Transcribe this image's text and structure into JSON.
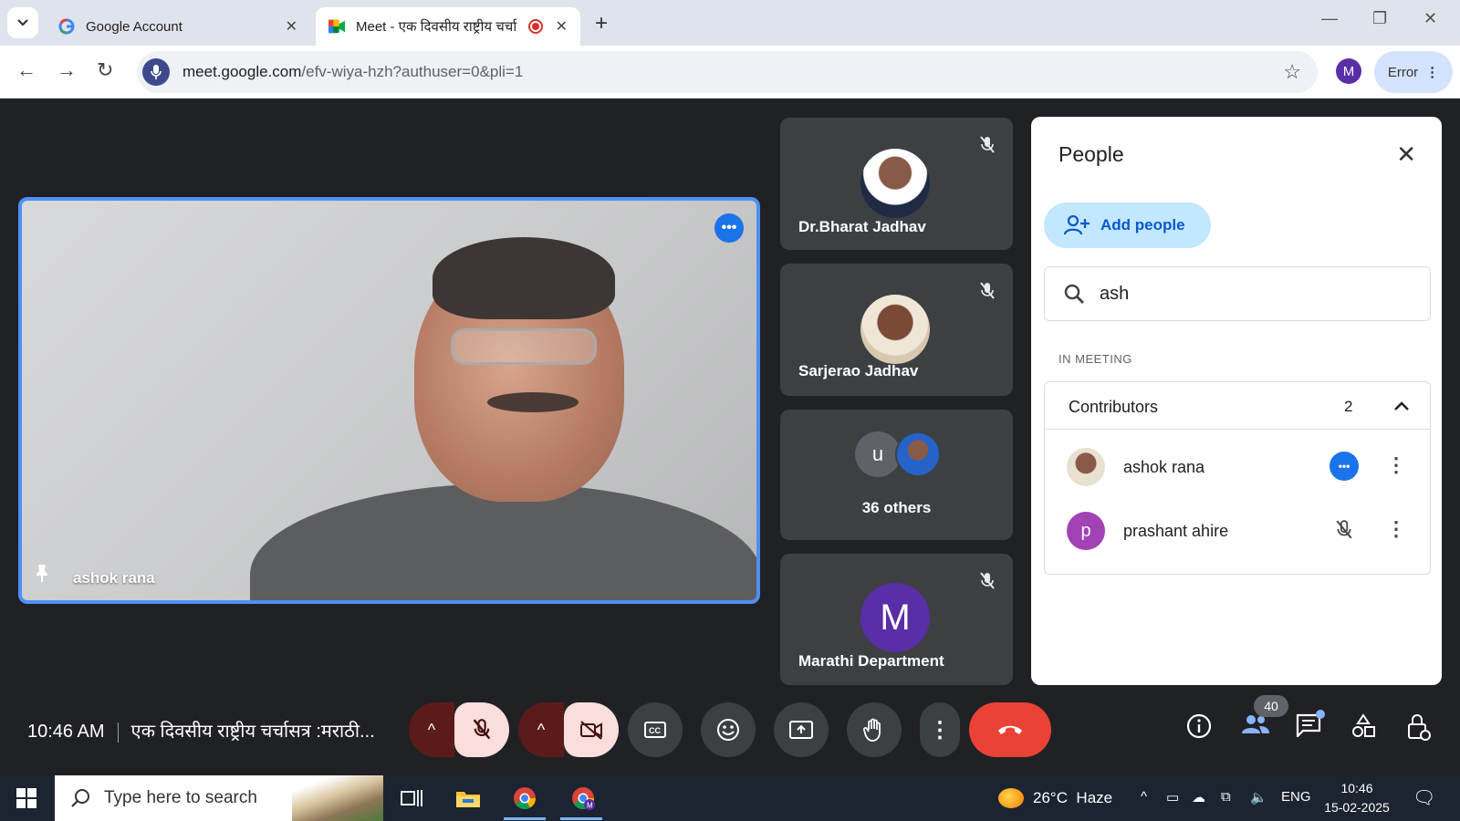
{
  "browser": {
    "tabs": [
      {
        "title": "Google Account",
        "favicon": "google-g-icon"
      },
      {
        "title": "Meet - एक दिवसीय राष्ट्रीय चर्चा",
        "favicon": "google-meet-icon",
        "recording": true
      }
    ],
    "url_host": "meet.google.com",
    "url_path": "/efv-wiya-hzh?authuser=0&pli=1",
    "profile_initial": "M",
    "error_label": "Error"
  },
  "meet": {
    "main_tile": {
      "name": "ashok rana"
    },
    "side_tiles": [
      {
        "name": "Dr.Bharat Jadhav",
        "muted": true
      },
      {
        "name": "Sarjerao Jadhav",
        "muted": true
      },
      {
        "avatar_letter": "u",
        "label": "36 others"
      },
      {
        "name": "Marathi Department",
        "avatar_letter": "M",
        "muted": true
      }
    ],
    "time": "10:46 AM",
    "meeting_title": "एक दिवसीय राष्ट्रीय चर्चासत्र :मराठी...",
    "participant_count": "40",
    "colors": {
      "accent": "#1a73e8",
      "hangup": "#ea4335",
      "panel_bg": "#ffffff",
      "tile_bg": "#3c4043"
    }
  },
  "people_panel": {
    "title": "People",
    "add_people_label": "Add people",
    "search_value": "ash",
    "section_label": "IN MEETING",
    "contributors_label": "Contributors",
    "contributors_count": "2",
    "participants": [
      {
        "name": "ashok rana",
        "status": "speaking"
      },
      {
        "name": "prashant ahire",
        "avatar_letter": "p",
        "status": "muted"
      }
    ]
  },
  "taskbar": {
    "search_placeholder": "Type here to search",
    "weather": "26°C  Haze",
    "language": "ENG",
    "time": "10:46",
    "date": "15-02-2025"
  }
}
